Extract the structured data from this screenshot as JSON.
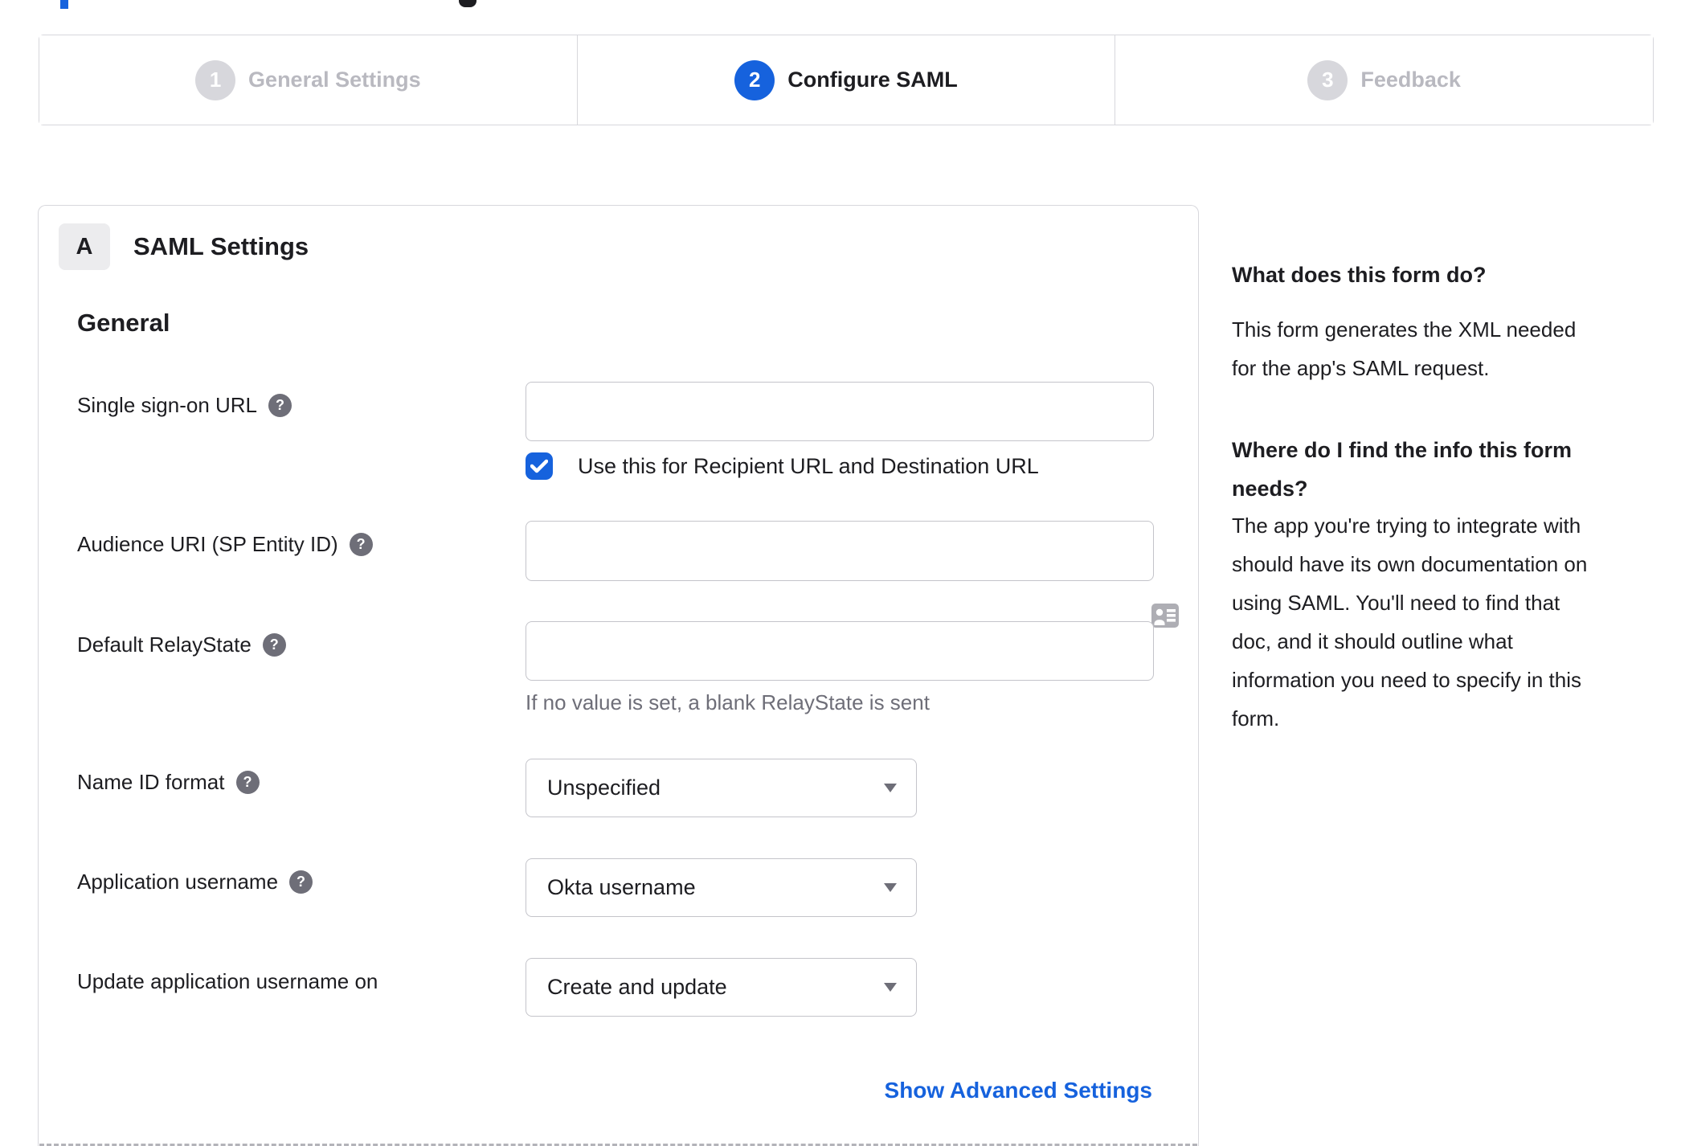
{
  "stepper": {
    "steps": [
      {
        "number": "1",
        "label": "General Settings",
        "state": "done"
      },
      {
        "number": "2",
        "label": "Configure SAML",
        "state": "active"
      },
      {
        "number": "3",
        "label": "Feedback",
        "state": "upcoming"
      }
    ]
  },
  "panel": {
    "badge": "A",
    "title": "SAML Settings",
    "section_heading": "General",
    "fields": {
      "sso": {
        "label": "Single sign-on URL",
        "value": "",
        "checkbox_label": "Use this for Recipient URL and Destination URL",
        "checkbox_checked": true
      },
      "audience": {
        "label": "Audience URI (SP Entity ID)",
        "value": ""
      },
      "relay": {
        "label": "Default RelayState",
        "value": "",
        "helper": "If no value is set, a blank RelayState is sent"
      },
      "name_id": {
        "label": "Name ID format",
        "value": "Unspecified"
      },
      "app_username": {
        "label": "Application username",
        "value": "Okta username"
      },
      "update_on": {
        "label": "Update application username on",
        "value": "Create and update"
      }
    },
    "advanced_link": "Show Advanced Settings"
  },
  "help_sidebar": {
    "q1": "What does this form do?",
    "a1_lines": [
      "This form generates the XML needed",
      "for the app's SAML request."
    ],
    "q2_lines": [
      "Where do I find the info this form",
      "needs?"
    ],
    "a2_lines": [
      "The app you're trying to integrate with",
      "should have its own documentation on",
      "using SAML. You'll need to find that",
      "doc, and it should outline what",
      "information you need to specify in this",
      "form."
    ]
  },
  "icons": {
    "help_glyph": "?"
  },
  "colors": {
    "accent_blue": "#1662dd",
    "text_dark": "#1d1d21",
    "text_muted": "#6e6e78",
    "inactive_gray": "#d7d7dc",
    "border_gray": "#c4c4ca"
  }
}
